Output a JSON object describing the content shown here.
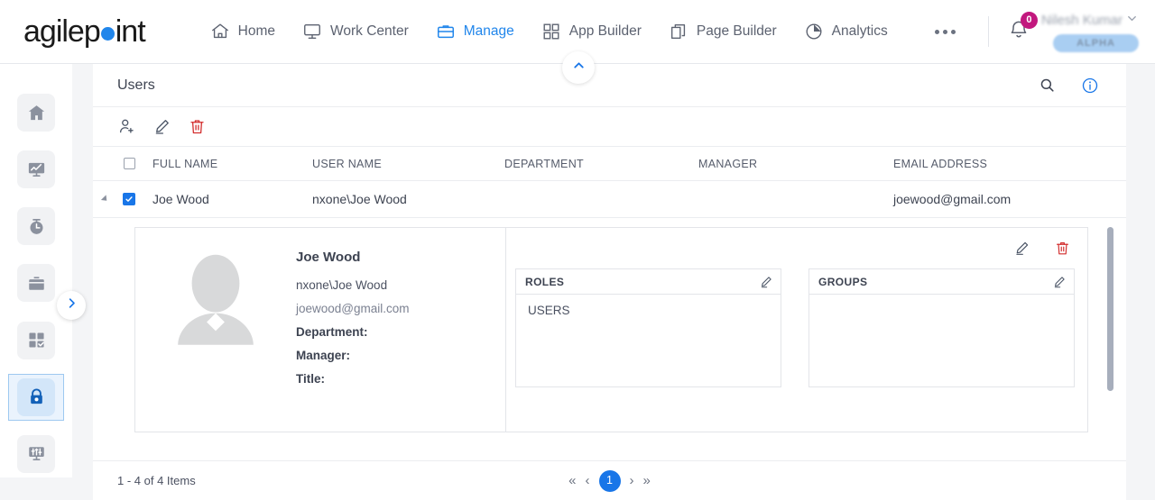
{
  "brand": {
    "name_part1": "agilep",
    "dot": "o",
    "name_part2": "int"
  },
  "topnav": {
    "items": [
      {
        "label": "Home",
        "icon": "home-icon",
        "active": false
      },
      {
        "label": "Work Center",
        "icon": "monitor-icon",
        "active": false
      },
      {
        "label": "Manage",
        "icon": "briefcase-icon",
        "active": true
      },
      {
        "label": "App Builder",
        "icon": "grid-icon",
        "active": false
      },
      {
        "label": "Page Builder",
        "icon": "pages-icon",
        "active": false
      },
      {
        "label": "Analytics",
        "icon": "pie-chart-icon",
        "active": false
      }
    ],
    "overflow": "more-icon",
    "notification_count": "0",
    "user_name": "Nilesh Kumar",
    "environment_badge": "ALPHA",
    "collapse_icon": "chevron-up-icon"
  },
  "rail": {
    "items": [
      {
        "name": "home",
        "icon": "home-icon",
        "active": false
      },
      {
        "name": "analytics",
        "icon": "chart-monitor-icon",
        "active": false
      },
      {
        "name": "time",
        "icon": "stopwatch-icon",
        "active": false
      },
      {
        "name": "work",
        "icon": "briefcase-icon",
        "active": false
      },
      {
        "name": "apps",
        "icon": "grid-check-icon",
        "active": false
      },
      {
        "name": "access-control",
        "icon": "lock-icon",
        "active": true
      },
      {
        "name": "settings",
        "icon": "sliders-icon",
        "active": false
      }
    ],
    "expand_icon": "chevron-right-icon"
  },
  "card": {
    "title": "Users",
    "title_actions": [
      {
        "name": "search",
        "icon": "search-icon"
      },
      {
        "name": "info",
        "icon": "info-icon"
      }
    ],
    "toolbar": [
      {
        "name": "add-user",
        "icon": "user-plus-icon"
      },
      {
        "name": "edit-user",
        "icon": "pencil-icon"
      },
      {
        "name": "delete-user",
        "icon": "trash-icon"
      }
    ]
  },
  "grid": {
    "columns": [
      "FULL NAME",
      "USER NAME",
      "DEPARTMENT",
      "MANAGER",
      "EMAIL ADDRESS"
    ],
    "select_all_checked": false,
    "rows": [
      {
        "selected": true,
        "expanded": true,
        "full_name": "Joe Wood",
        "user_name": "nxone\\Joe Wood",
        "department": "",
        "manager": "",
        "email_address": "joewood@gmail.com"
      }
    ]
  },
  "detail": {
    "avatar_icon": "user-avatar-placeholder",
    "name": "Joe Wood",
    "user_name": "nxone\\Joe Wood",
    "email": "joewood@gmail.com",
    "department_label": "Department:",
    "department_value": "",
    "manager_label": "Manager:",
    "manager_value": "",
    "title_label": "Title:",
    "title_value": "",
    "actions": [
      {
        "name": "edit-detail",
        "icon": "pencil-icon"
      },
      {
        "name": "delete-detail",
        "icon": "trash-icon"
      }
    ],
    "roles": {
      "header": "ROLES",
      "edit_icon": "pencil-icon",
      "items": [
        "USERS"
      ]
    },
    "groups": {
      "header": "GROUPS",
      "edit_icon": "pencil-icon",
      "items": []
    }
  },
  "footer": {
    "items_count": "1 - 4 of 4 Items",
    "pager": {
      "first": "«",
      "prev": "‹",
      "current": "1",
      "next": "›",
      "last": "»"
    }
  },
  "colors": {
    "accent": "#2186eb",
    "accent_dark": "#1976e8",
    "danger": "#d32f2f",
    "badge": "#c2187e",
    "text": "#3d4351",
    "muted": "#7b8191",
    "page_bg": "#f4f5f7"
  }
}
